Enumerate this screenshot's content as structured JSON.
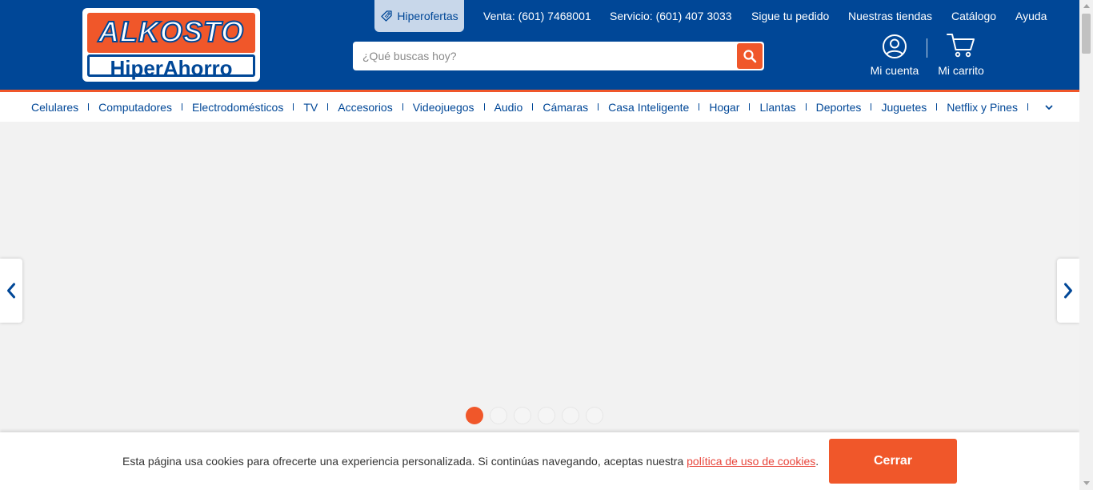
{
  "brand": {
    "logo_top": "ALKOSTO",
    "logo_bottom": "HiperAhorro",
    "colors": {
      "primary": "#004797",
      "accent": "#f0572a",
      "link_red": "#e8463c"
    }
  },
  "topbar": {
    "hiperofertas": {
      "label": "Hiperofertas",
      "icon": "tag-icon"
    },
    "links": [
      "Venta: (601) 7468001",
      "Servicio: (601) 407 3033",
      "Sigue tu pedido",
      "Nuestras tiendas",
      "Catálogo",
      "Ayuda"
    ]
  },
  "search": {
    "placeholder": "¿Qué buscas hoy?",
    "value": "",
    "button_icon": "search-icon"
  },
  "account": {
    "label": "Mi cuenta",
    "icon": "user-circle-icon"
  },
  "cart": {
    "label": "Mi carrito",
    "icon": "shopping-cart-icon"
  },
  "categories": {
    "items": [
      "Celulares",
      "Computadores",
      "Electrodomésticos",
      "TV",
      "Accesorios",
      "Videojuegos",
      "Audio",
      "Cámaras",
      "Casa Inteligente",
      "Hogar",
      "Llantas",
      "Deportes",
      "Juguetes",
      "Netflix y Pines"
    ],
    "more_icon": "chevron-down-icon"
  },
  "carousel": {
    "prev_icon": "chevron-left-icon",
    "next_icon": "chevron-right-icon",
    "slide_count": 6,
    "active_index": 0
  },
  "cookie_banner": {
    "message": "Esta página usa cookies para ofrecerte una experiencia personalizada. Si continúas navegando, aceptas nuestra ",
    "policy_link": "política de uso de cookies",
    "suffix": ".",
    "close_label": "Cerrar"
  }
}
